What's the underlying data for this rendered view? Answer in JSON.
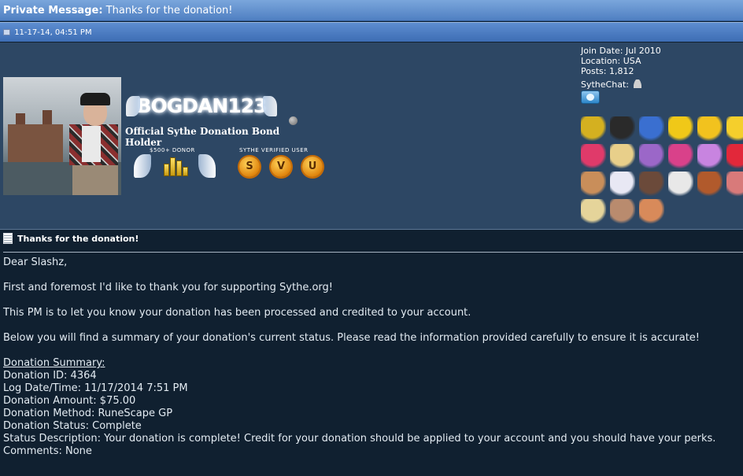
{
  "titlebar": {
    "label": "Private Message:",
    "subject": "Thanks for the donation!"
  },
  "datebar": {
    "date": "11-17-14, 04:51 PM"
  },
  "user": {
    "username": "BOGDAN123",
    "title": "Official Sythe Donation Bond Holder",
    "donor_badge_label": "$500+ DONOR",
    "svu_badge_label": "SYTHE VERIFIED USER",
    "svu_letters": [
      "S",
      "V",
      "U"
    ],
    "join_date": "Join Date: Jul 2010",
    "location": "Location: USA",
    "posts": "Posts: 1,812",
    "sythechat": "SytheChat:"
  },
  "awards": [
    {
      "name": "gold-stack-award",
      "color": "#d4b020"
    },
    {
      "name": "robot-award",
      "color": "#2a2a2a"
    },
    {
      "name": "penguin-award",
      "color": "#3a6fd0"
    },
    {
      "name": "anarchy-award",
      "color": "#f0c818"
    },
    {
      "name": "jake-award",
      "color": "#f2c21e"
    },
    {
      "name": "sunglasses-award",
      "color": "#f5cf2c"
    },
    {
      "name": "rainbow-award",
      "color": "#e03a6a"
    },
    {
      "name": "blonde-award",
      "color": "#e8cf8a"
    },
    {
      "name": "pony-award",
      "color": "#9b67c8"
    },
    {
      "name": "crystal-award",
      "color": "#d9418a"
    },
    {
      "name": "ghost-award",
      "color": "#c884e0"
    },
    {
      "name": "candycane-award",
      "color": "#e2283a"
    },
    {
      "name": "king-award",
      "color": "#c98e5a"
    },
    {
      "name": "unicorn-award",
      "color": "#e8e8f4"
    },
    {
      "name": "face-award",
      "color": "#6b4a3a"
    },
    {
      "name": "chef-award",
      "color": "#e8e8e8"
    },
    {
      "name": "monkey-award",
      "color": "#b15a2c"
    },
    {
      "name": "pink-award",
      "color": "#d87a7a"
    },
    {
      "name": "cartoon-award",
      "color": "#e5d49a"
    },
    {
      "name": "man-award",
      "color": "#b98b6e"
    },
    {
      "name": "redhead-award",
      "color": "#d88a5a"
    }
  ],
  "message": {
    "heading": "Thanks for the donation!",
    "greeting": "Dear Slashz,",
    "p1": "First and foremost I'd like to thank you for supporting Sythe.org!",
    "p2": "This PM is to let you know your donation has been processed and credited to your account.",
    "p3": "Below you will find a summary of your donation's current status. Please read the information provided carefully to ensure it is accurate!",
    "summary_heading": "Donation Summary:",
    "summary": [
      "Donation ID: 4364",
      "Log Date/Time: 11/17/2014 7:51 PM",
      "Donation Amount: $75.00",
      "Donation Method: RuneScape GP",
      "Donation Status: Complete",
      "Status Description: Your donation is complete! Credit for your donation should be applied to your account and you should have your perks.",
      "Comments: None"
    ]
  }
}
